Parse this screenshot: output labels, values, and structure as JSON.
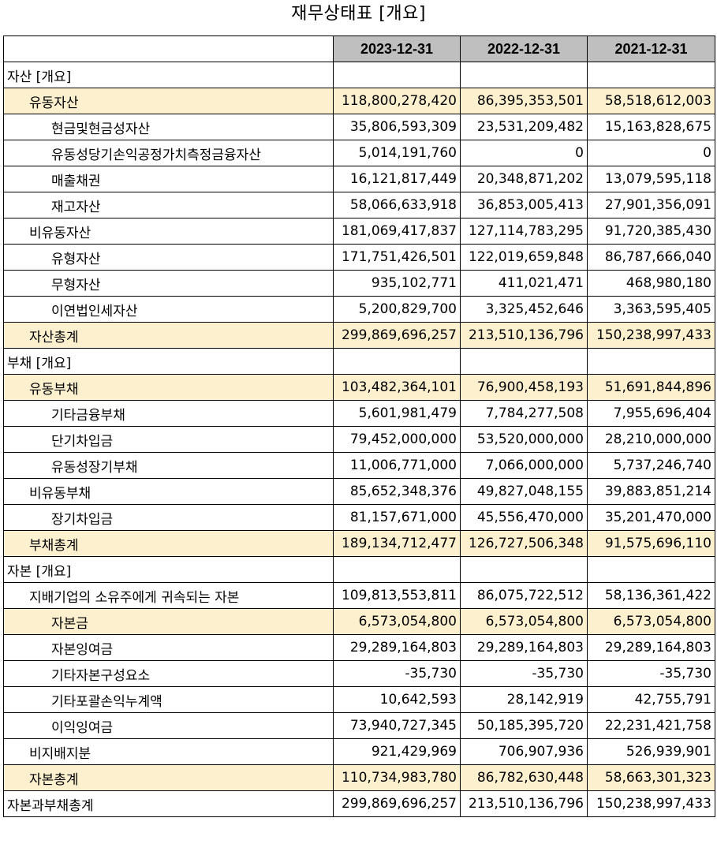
{
  "title": "재무상태표 [개요]",
  "headers": [
    "2023-12-31",
    "2022-12-31",
    "2021-12-31"
  ],
  "rows": [
    {
      "label": "자산 [개요]",
      "level": 0,
      "highlight": false,
      "values": [
        "",
        "",
        ""
      ]
    },
    {
      "label": "유동자산",
      "level": 1,
      "highlight": true,
      "values": [
        "118,800,278,420",
        "86,395,353,501",
        "58,518,612,003"
      ]
    },
    {
      "label": "현금및현금성자산",
      "level": 2,
      "highlight": false,
      "values": [
        "35,806,593,309",
        "23,531,209,482",
        "15,163,828,675"
      ]
    },
    {
      "label": "유동성당기손익공정가치측정금융자산",
      "level": 2,
      "highlight": false,
      "values": [
        "5,014,191,760",
        "0",
        "0"
      ]
    },
    {
      "label": "매출채권",
      "level": 2,
      "highlight": false,
      "values": [
        "16,121,817,449",
        "20,348,871,202",
        "13,079,595,118"
      ]
    },
    {
      "label": "재고자산",
      "level": 2,
      "highlight": false,
      "values": [
        "58,066,633,918",
        "36,853,005,413",
        "27,901,356,091"
      ]
    },
    {
      "label": "비유동자산",
      "level": 1,
      "highlight": false,
      "values": [
        "181,069,417,837",
        "127,114,783,295",
        "91,720,385,430"
      ]
    },
    {
      "label": "유형자산",
      "level": 2,
      "highlight": false,
      "values": [
        "171,751,426,501",
        "122,019,659,848",
        "86,787,666,040"
      ]
    },
    {
      "label": "무형자산",
      "level": 2,
      "highlight": false,
      "values": [
        "935,102,771",
        "411,021,471",
        "468,980,180"
      ]
    },
    {
      "label": "이연법인세자산",
      "level": 2,
      "highlight": false,
      "values": [
        "5,200,829,700",
        "3,325,452,646",
        "3,363,595,405"
      ]
    },
    {
      "label": "자산총계",
      "level": 1,
      "highlight": true,
      "values": [
        "299,869,696,257",
        "213,510,136,796",
        "150,238,997,433"
      ]
    },
    {
      "label": "부채 [개요]",
      "level": 0,
      "highlight": false,
      "values": [
        "",
        "",
        ""
      ]
    },
    {
      "label": "유동부채",
      "level": 1,
      "highlight": true,
      "values": [
        "103,482,364,101",
        "76,900,458,193",
        "51,691,844,896"
      ]
    },
    {
      "label": "기타금융부채",
      "level": 2,
      "highlight": false,
      "values": [
        "5,601,981,479",
        "7,784,277,508",
        "7,955,696,404"
      ]
    },
    {
      "label": "단기차입금",
      "level": 2,
      "highlight": false,
      "values": [
        "79,452,000,000",
        "53,520,000,000",
        "28,210,000,000"
      ]
    },
    {
      "label": "유동성장기부채",
      "level": 2,
      "highlight": false,
      "values": [
        "11,006,771,000",
        "7,066,000,000",
        "5,737,246,740"
      ]
    },
    {
      "label": "비유동부채",
      "level": 1,
      "highlight": false,
      "values": [
        "85,652,348,376",
        "49,827,048,155",
        "39,883,851,214"
      ]
    },
    {
      "label": "장기차입금",
      "level": 2,
      "highlight": false,
      "values": [
        "81,157,671,000",
        "45,556,470,000",
        "35,201,470,000"
      ]
    },
    {
      "label": "부채총계",
      "level": 1,
      "highlight": true,
      "values": [
        "189,134,712,477",
        "126,727,506,348",
        "91,575,696,110"
      ]
    },
    {
      "label": "자본 [개요]",
      "level": 0,
      "highlight": false,
      "values": [
        "",
        "",
        ""
      ]
    },
    {
      "label": "지배기업의 소유주에게 귀속되는 자본",
      "level": 1,
      "highlight": false,
      "values": [
        "109,813,553,811",
        "86,075,722,512",
        "58,136,361,422"
      ]
    },
    {
      "label": "자본금",
      "level": 2,
      "highlight": true,
      "values": [
        "6,573,054,800",
        "6,573,054,800",
        "6,573,054,800"
      ]
    },
    {
      "label": "자본잉여금",
      "level": 2,
      "highlight": false,
      "values": [
        "29,289,164,803",
        "29,289,164,803",
        "29,289,164,803"
      ]
    },
    {
      "label": "기타자본구성요소",
      "level": 2,
      "highlight": false,
      "values": [
        "-35,730",
        "-35,730",
        "-35,730"
      ]
    },
    {
      "label": "기타포괄손익누계액",
      "level": 2,
      "highlight": false,
      "values": [
        "10,642,593",
        "28,142,919",
        "42,755,791"
      ]
    },
    {
      "label": "이익잉여금",
      "level": 2,
      "highlight": false,
      "values": [
        "73,940,727,345",
        "50,185,395,720",
        "22,231,421,758"
      ]
    },
    {
      "label": "비지배지분",
      "level": 1,
      "highlight": false,
      "values": [
        "921,429,969",
        "706,907,936",
        "526,939,901"
      ]
    },
    {
      "label": "자본총계",
      "level": 1,
      "highlight": true,
      "values": [
        "110,734,983,780",
        "86,782,630,448",
        "58,663,301,323"
      ]
    },
    {
      "label": "자본과부채총계",
      "level": 0,
      "highlight": false,
      "values": [
        "299,869,696,257",
        "213,510,136,796",
        "150,238,997,433"
      ]
    }
  ],
  "colors": {
    "header_bg": "#bfbfbf",
    "highlight_bg": "#fdf0cf",
    "border": "#000000"
  }
}
